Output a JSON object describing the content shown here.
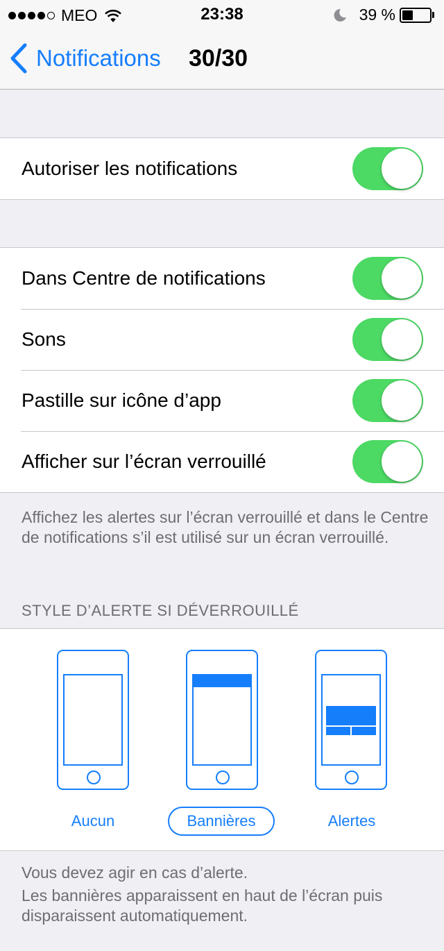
{
  "status_bar": {
    "signal_dots_filled": 4,
    "signal_dots_total": 5,
    "carrier": "MEO",
    "time": "23:38",
    "battery_percent": "39 %",
    "battery_level": 0.39,
    "icons": [
      "wifi-icon",
      "moon-icon",
      "battery-icon"
    ]
  },
  "nav": {
    "back_label": "Notifications",
    "title": "30/30"
  },
  "allow_group": {
    "rows": [
      {
        "label": "Autoriser les notifications",
        "on": true
      }
    ]
  },
  "options_group": {
    "rows": [
      {
        "label": "Dans Centre de notifications",
        "on": true
      },
      {
        "label": "Sons",
        "on": true
      },
      {
        "label": "Pastille sur icône d’app",
        "on": true
      },
      {
        "label": "Afficher sur l’écran verrouillé",
        "on": true
      }
    ],
    "footer": "Affichez les alertes sur l’écran verrouillé et dans le Centre de notifications s’il est utilisé sur un écran verrouillé."
  },
  "alert_style": {
    "header": "STYLE D’ALERTE SI DÉVERROUILLÉ",
    "options": [
      {
        "label": "Aucun",
        "selected": false
      },
      {
        "label": "Bannières",
        "selected": true
      },
      {
        "label": "Alertes",
        "selected": false
      }
    ],
    "footer_line1": "Vous devez agir en cas d’alerte.",
    "footer_line2": "Les bannières apparaissent en haut de l’écran puis disparaissent automatiquement."
  },
  "colors": {
    "accent": "#157efb",
    "switch_on": "#4cd964",
    "background": "#efeff4",
    "footer_text": "#6d6d72"
  }
}
